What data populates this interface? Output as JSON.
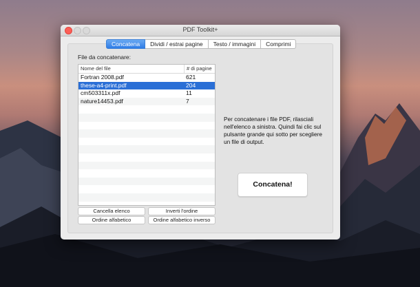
{
  "window": {
    "title": "PDF Toolkit+"
  },
  "tabs": [
    {
      "label": "Concatena",
      "active": true
    },
    {
      "label": "Dividi / estrai pagine",
      "active": false
    },
    {
      "label": "Testo / immagini",
      "active": false
    },
    {
      "label": "Comprimi",
      "active": false
    }
  ],
  "files_section": {
    "label": "File da concatenare:",
    "columns": {
      "name": "Nome del file",
      "pages": "# di pagine"
    },
    "rows": [
      {
        "name": "Fortran 2008.pdf",
        "pages": "621",
        "selected": false
      },
      {
        "name": "these-a4-print.pdf",
        "pages": "204",
        "selected": true
      },
      {
        "name": "cm503311x.pdf",
        "pages": "11",
        "selected": false
      },
      {
        "name": "nature14453.pdf",
        "pages": "7",
        "selected": false
      }
    ]
  },
  "buttons": {
    "clear_list": "Cancella elenco",
    "invert_order": "Inverti l'ordine",
    "alpha_order": "Ordine alfabetico",
    "alpha_inverse": "Ordine alfabetico inverso"
  },
  "instructions": "Per concatenare i file PDF, rilasciali nell'elenco a sinistra. Quindi fai clic sul pulsante grande qui sotto per scegliere un file di output.",
  "concat_button": "Concatena!",
  "colors": {
    "accent": "#2f7ce7",
    "selection": "#2a6fd6",
    "close": "#fc5f57"
  }
}
